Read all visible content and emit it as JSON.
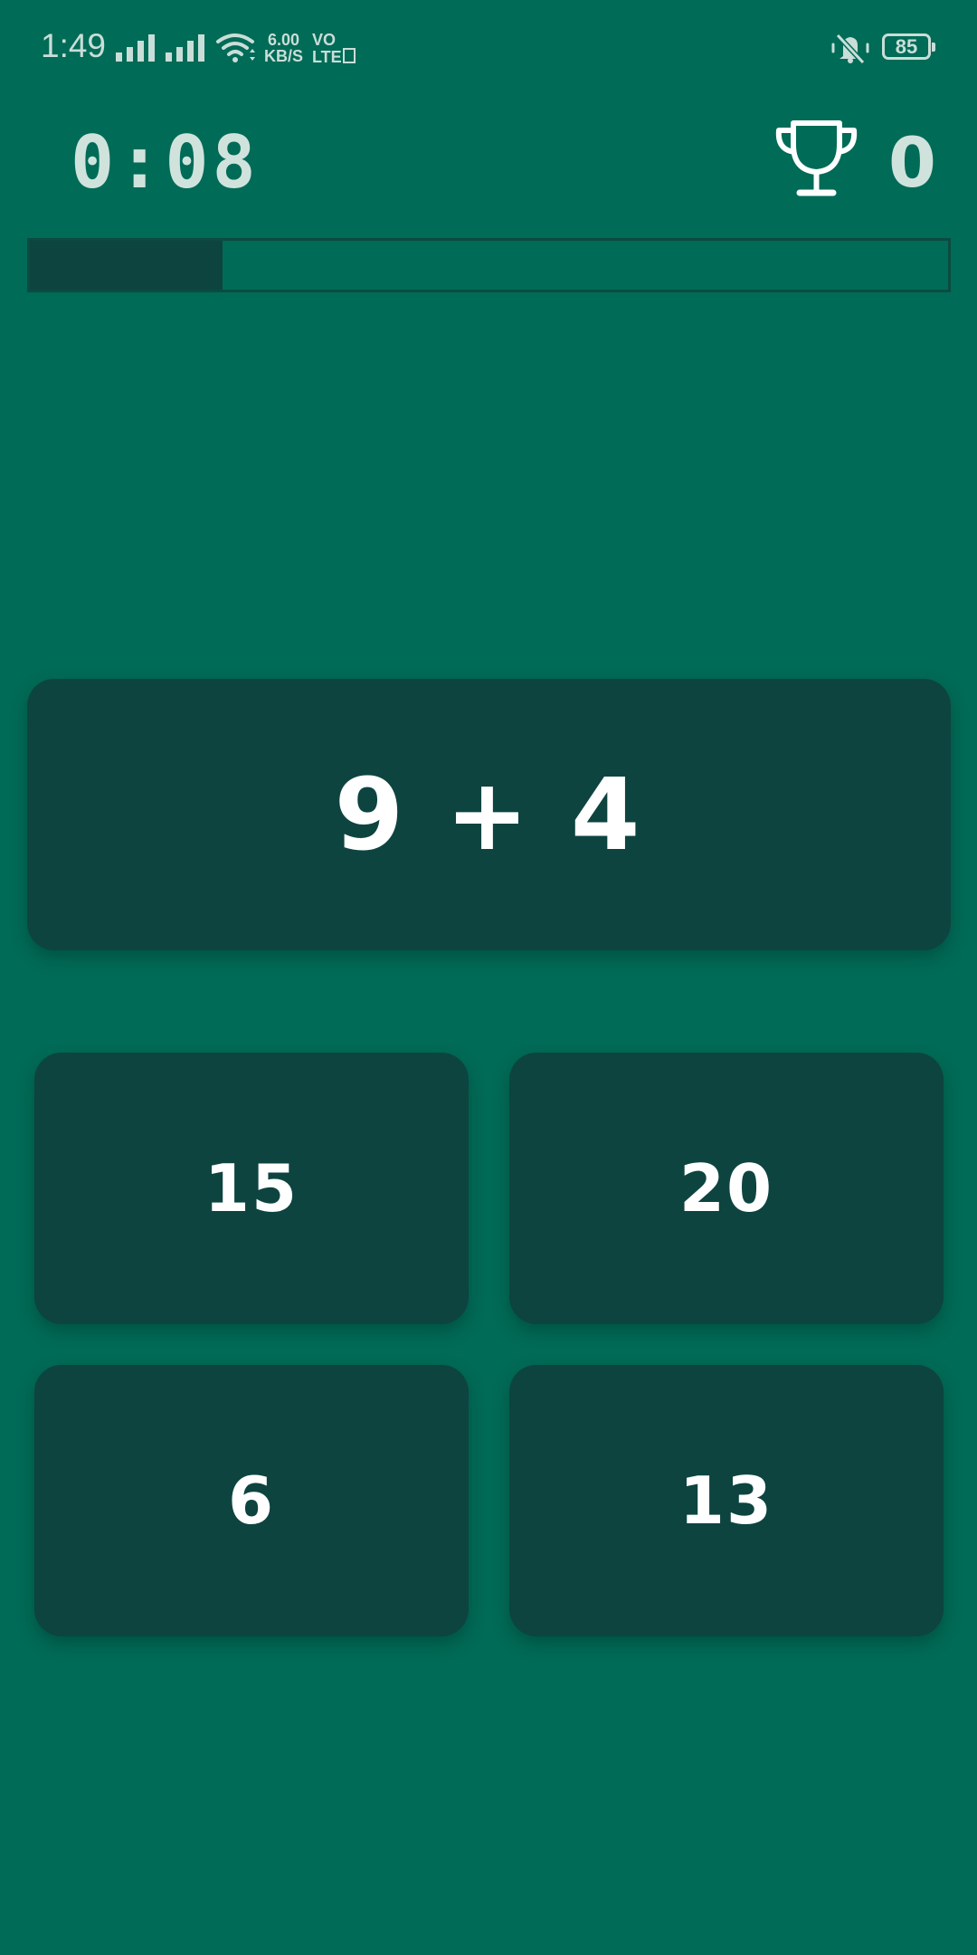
{
  "status_bar": {
    "time": "1:49",
    "net_speed_value": "6.00",
    "net_speed_unit": "KB/S",
    "volte_top": "VO",
    "volte_bottom": "LTE",
    "battery": "85",
    "icons": [
      "signal-icon",
      "signal-icon",
      "wifi-icon",
      "mute-icon",
      "battery-icon"
    ]
  },
  "game": {
    "timer": "0:08",
    "score": "0",
    "progress_fraction": 0.21,
    "question": "9 + 4",
    "answers": [
      "15",
      "20",
      "6",
      "13"
    ]
  },
  "colors": {
    "background": "#006b57",
    "card": "#0d4440",
    "text": "#ffffff",
    "muted_text": "#cfe3dc"
  }
}
